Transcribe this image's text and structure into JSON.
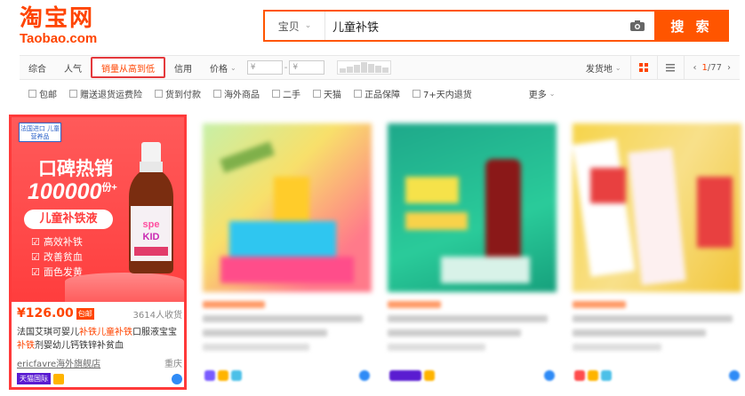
{
  "header": {
    "logo_cn": "淘宝网",
    "logo_en": "Taobao.com",
    "search_category": "宝贝",
    "search_query": "儿童补铁",
    "search_button": "搜 索"
  },
  "filters": {
    "sort_tabs": [
      "综合",
      "人气",
      "销量从高到低",
      "信用",
      "价格"
    ],
    "active_sort": "销量从高到低",
    "price_from_placeholder": "¥",
    "price_to_placeholder": "¥",
    "ship_from": "发货地",
    "page_current": "1",
    "page_total": "/77"
  },
  "checks": {
    "items": [
      "包邮",
      "赠送退货运费险",
      "货到付款",
      "海外商品",
      "二手",
      "天猫",
      "正品保障",
      "7+天内退货"
    ],
    "more": "更多"
  },
  "product": {
    "promo_tag": "法国进口 儿童营养品",
    "promo_headline": "口碑热销",
    "promo_number": "100000",
    "promo_suffix": "份+",
    "promo_pill": "儿童补铁液",
    "promo_points": [
      "高效补铁",
      "改善贫血",
      "面色发黄"
    ],
    "price": "¥126.00",
    "baoyou": "包邮",
    "sales": "3614人收货",
    "title_parts": [
      "法国艾琪可婴儿",
      "补铁儿童补铁",
      "口服液宝宝",
      "补铁",
      "剂婴幼儿钙铁锌补贫血"
    ],
    "shop": "ericfavre海外旗舰店",
    "location": "重庆",
    "tmall_badge": "天猫国际"
  },
  "colors": {
    "brand": "#ff4400",
    "highlight_border": "#ff3a3a"
  }
}
